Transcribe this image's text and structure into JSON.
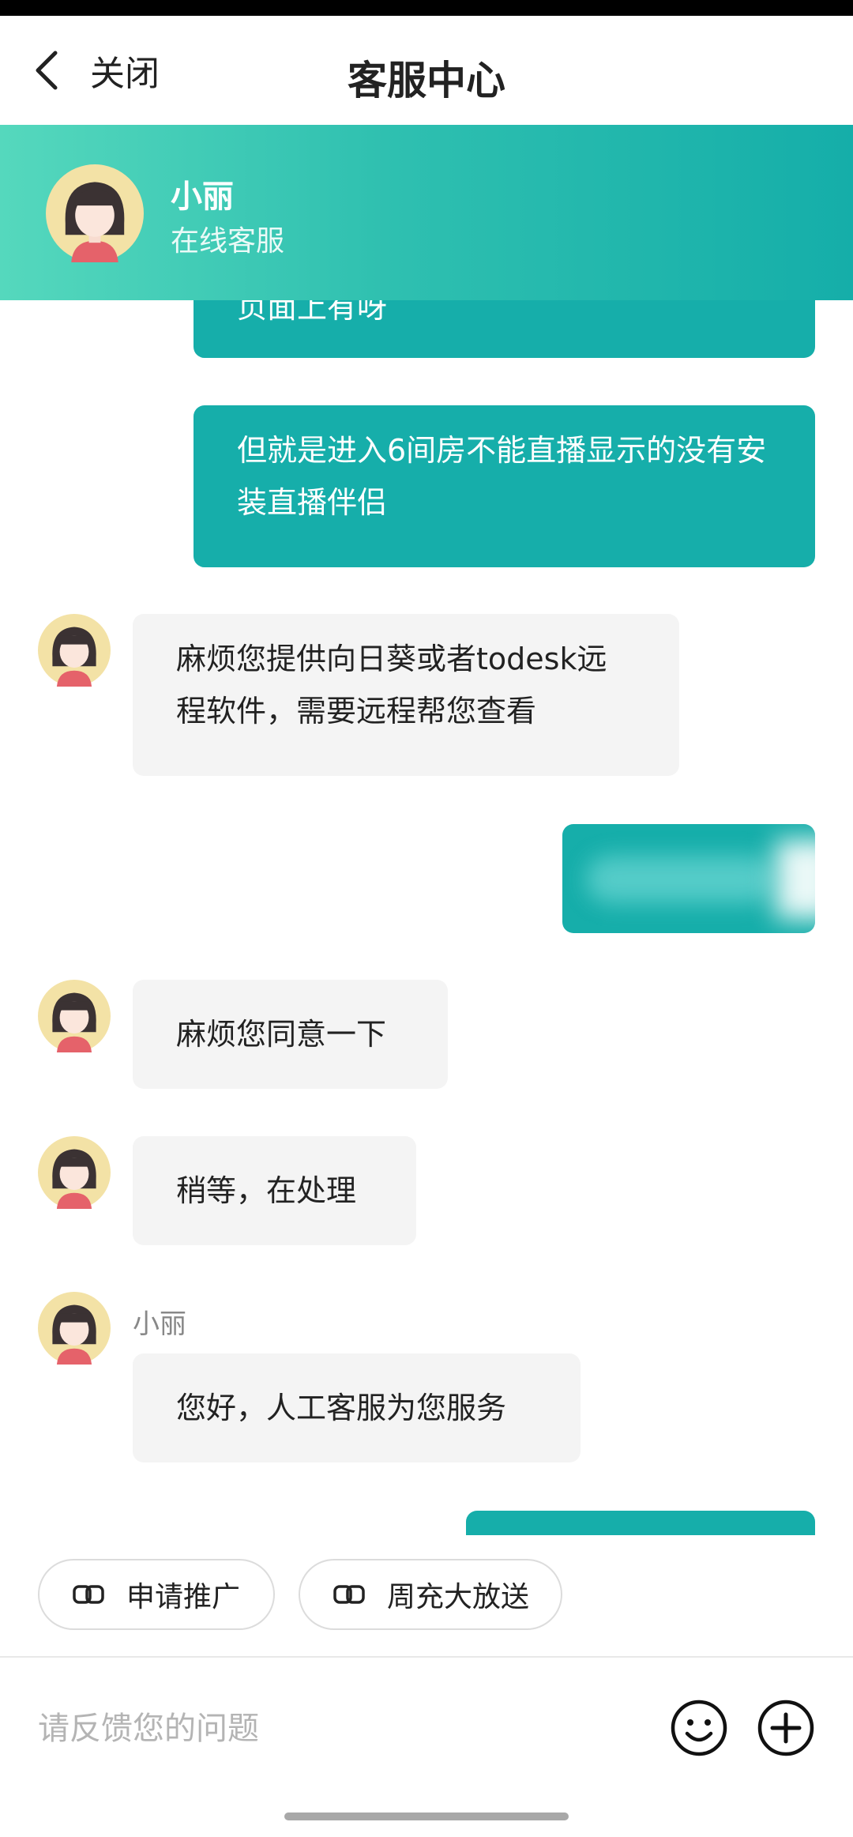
{
  "header": {
    "back_label": "关闭",
    "title": "客服中心"
  },
  "agent": {
    "name": "小丽",
    "status": "在线客服"
  },
  "messages": [
    {
      "from": "user",
      "text": "页面上有呀"
    },
    {
      "from": "user",
      "text": "但就是进入6间房不能直播显示的没有安装直播伴侣"
    },
    {
      "from": "agent",
      "text": "麻烦您提供向日葵或者todesk远程软件，需要远程帮您查看"
    },
    {
      "from": "user",
      "text": ""
    },
    {
      "from": "agent",
      "text": "麻烦您同意一下"
    },
    {
      "from": "agent",
      "text": "稍等，在处理"
    },
    {
      "from": "agent",
      "sender": "小丽",
      "text": "您好，人工客服为您服务"
    }
  ],
  "quick_replies": [
    {
      "label": "申请推广",
      "icon": "link-icon"
    },
    {
      "label": "周充大放送",
      "icon": "link-icon"
    }
  ],
  "composer": {
    "placeholder": "请反馈您的问题",
    "emoji_icon": "smiley-icon",
    "plus_icon": "plus-circle-icon"
  },
  "colors": {
    "accent": "#16aeaa",
    "banner_start": "#55d8bd",
    "banner_end": "#15aea9",
    "agent_bubble": "#f4f4f4"
  }
}
